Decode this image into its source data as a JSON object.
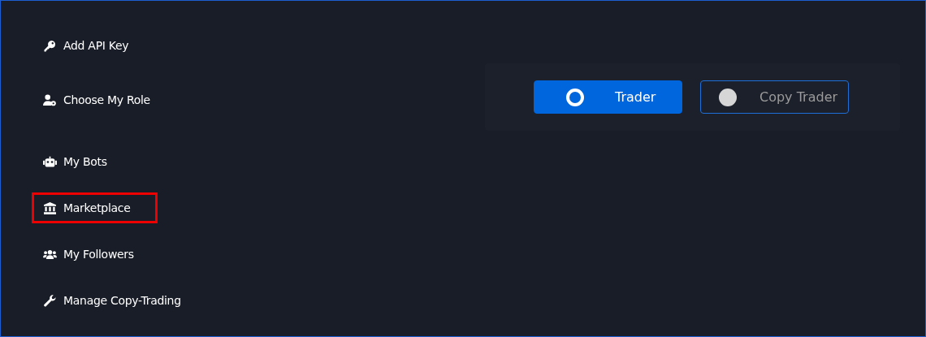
{
  "sidebar": {
    "items": [
      {
        "label": "Add API Key",
        "kind": "key",
        "highlighted": false
      },
      {
        "label": "Choose My Role",
        "kind": "user-gear",
        "highlighted": false
      },
      {
        "label": "My Bots",
        "kind": "robot",
        "highlighted": false
      },
      {
        "label": "Marketplace",
        "kind": "bank",
        "highlighted": true
      },
      {
        "label": "My Followers",
        "kind": "users",
        "highlighted": false
      },
      {
        "label": "Manage Copy-Trading",
        "kind": "wrench",
        "highlighted": false
      }
    ]
  },
  "role_options": [
    {
      "label": "Trader",
      "selected": true
    },
    {
      "label": "Copy Trader",
      "selected": false
    }
  ]
}
